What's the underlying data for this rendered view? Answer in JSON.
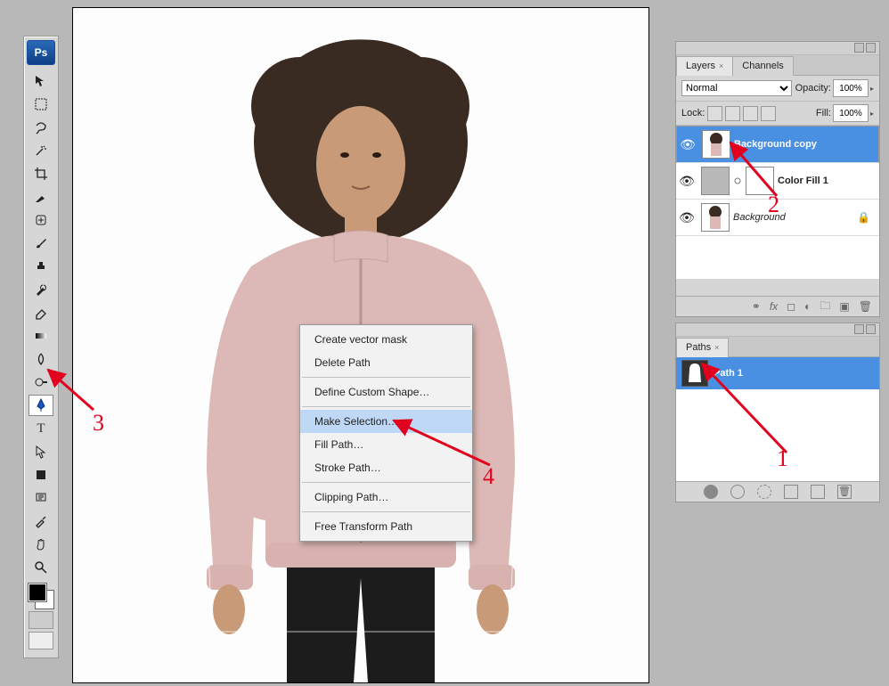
{
  "app": {
    "logo": "Ps"
  },
  "toolbox": {
    "tools": [
      "move",
      "marquee",
      "lasso",
      "wand",
      "crop",
      "slice",
      "brush",
      "stamp",
      "history",
      "eraser",
      "gradient",
      "blur",
      "dodge",
      "selection",
      "pen",
      "type",
      "direct",
      "shape",
      "notes",
      "eyedropper",
      "hand",
      "zoom"
    ],
    "selected_index": 14
  },
  "context_menu": {
    "items": [
      "Create vector mask",
      "Delete Path",
      "Define Custom Shape…",
      "Make Selection…",
      "Fill Path…",
      "Stroke Path…",
      "Clipping Path…",
      "Free Transform Path"
    ],
    "highlighted_index": 3,
    "separators_after": [
      1,
      2,
      5,
      6
    ]
  },
  "layers_panel": {
    "tabs": [
      "Layers",
      "Channels"
    ],
    "active_tab": 0,
    "blend_mode": "Normal",
    "opacity_label": "Opacity:",
    "opacity_value": "100%",
    "lock_label": "Lock:",
    "fill_label": "Fill:",
    "fill_value": "100%",
    "layers": [
      {
        "name": "Background copy",
        "type": "pixel",
        "selected": true,
        "visible": true,
        "italic": false,
        "locked": false
      },
      {
        "name": "Color Fill 1",
        "type": "fill",
        "selected": false,
        "visible": true,
        "italic": false,
        "locked": false
      },
      {
        "name": "Background",
        "type": "pixel",
        "selected": false,
        "visible": true,
        "italic": true,
        "locked": true
      }
    ]
  },
  "paths_panel": {
    "tab": "Paths",
    "items": [
      {
        "name": "Path 1",
        "selected": true
      }
    ]
  },
  "annotations": {
    "n1": "1",
    "n2": "2",
    "n3": "3",
    "n4": "4"
  },
  "colors": {
    "selection_blue": "#4a90e2",
    "menu_highlight": "#bed8f6",
    "annotation_red": "#e1001e"
  }
}
